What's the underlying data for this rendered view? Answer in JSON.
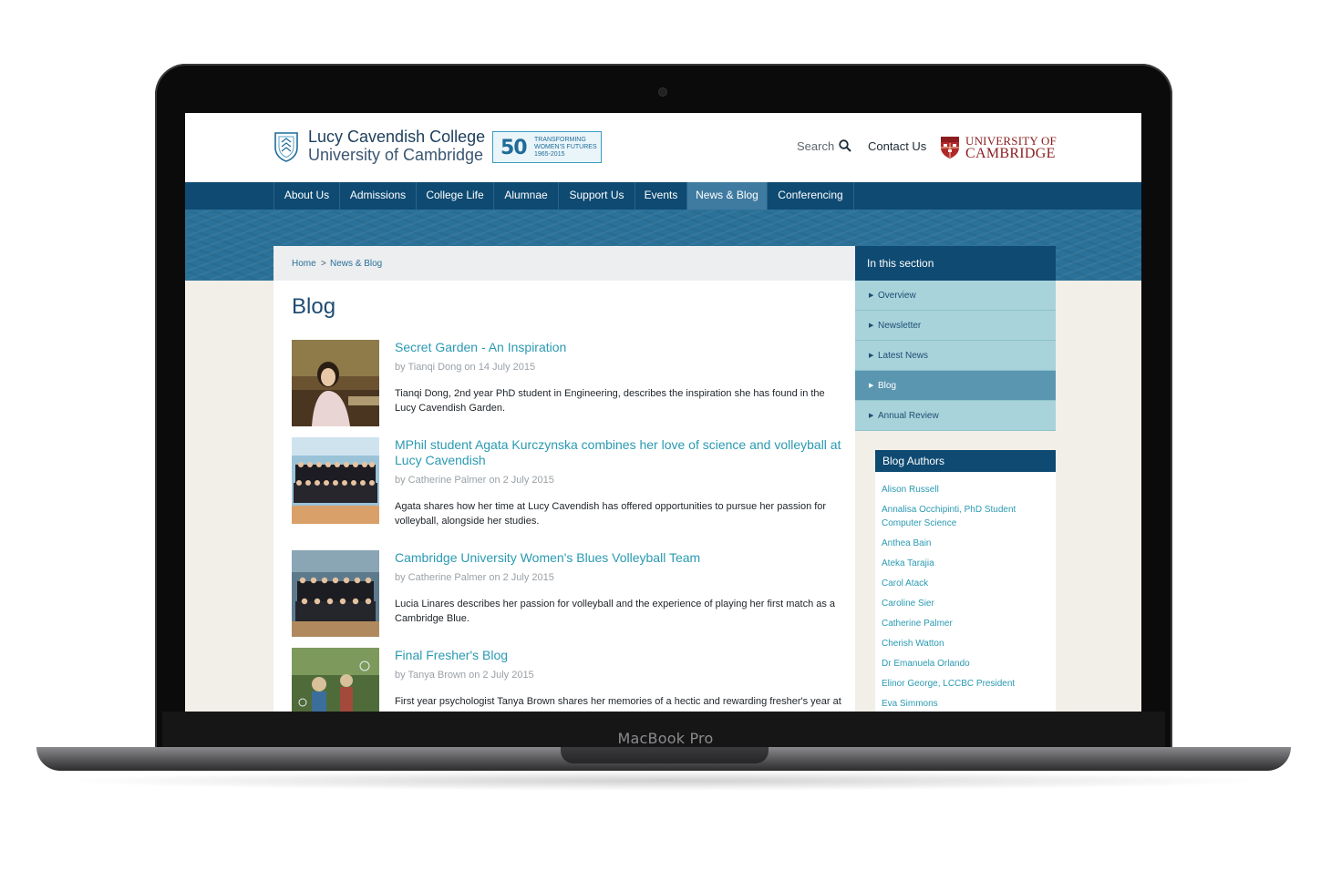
{
  "device": {
    "label": "MacBook Pro"
  },
  "header": {
    "college_name": "Lucy Cavendish College",
    "college_sub": "University of Cambridge",
    "anniversary_num": "50",
    "anniversary_text": "TRANSFORMING WOMEN'S FUTURES 1965-2015",
    "search_label": "Search",
    "contact_label": "Contact Us",
    "uni_line1": "UNIVERSITY OF",
    "uni_line2": "CAMBRIDGE"
  },
  "nav": {
    "items": [
      {
        "label": "About Us"
      },
      {
        "label": "Admissions"
      },
      {
        "label": "College Life"
      },
      {
        "label": "Alumnae"
      },
      {
        "label": "Support Us"
      },
      {
        "label": "Events"
      },
      {
        "label": "News & Blog"
      },
      {
        "label": "Conferencing"
      }
    ],
    "active": "News & Blog"
  },
  "breadcrumb": {
    "home": "Home",
    "separator": ">",
    "current": "News & Blog"
  },
  "page_title": "Blog",
  "posts": [
    {
      "title": "Secret Garden - An Inspiration",
      "meta": "by Tianqi Dong on 14 July 2015",
      "excerpt": "Tianqi Dong, 2nd year PhD student in Engineering, describes the inspiration she has found in the Lucy Cavendish Garden."
    },
    {
      "title": "MPhil student Agata Kurczynska combines her love of science and volleyball at Lucy Cavendish",
      "meta": "by Catherine Palmer on 2 July 2015",
      "excerpt": "Agata shares how her time at Lucy Cavendish has offered opportunities to pursue her passion for volleyball, alongside her studies."
    },
    {
      "title": "Cambridge University Women's Blues Volleyball Team",
      "meta": "by Catherine Palmer on 2 July 2015",
      "excerpt": "Lucia Linares describes her passion for volleyball and the experience of playing her first match as a Cambridge Blue."
    },
    {
      "title": "Final Fresher's Blog",
      "meta": "by Tanya Brown on 2 July 2015",
      "excerpt": "First year psychologist Tanya Brown shares her memories of a hectic and rewarding fresher's year at"
    }
  ],
  "sidebar": {
    "heading": "In this section",
    "items": [
      {
        "label": "Overview"
      },
      {
        "label": "Newsletter"
      },
      {
        "label": "Latest News"
      },
      {
        "label": "Blog"
      },
      {
        "label": "Annual Review"
      }
    ],
    "active": "Blog"
  },
  "authors": {
    "heading": "Blog Authors",
    "items": [
      "Alison Russell",
      "Annalisa Occhipinti, PhD Student Computer Science",
      "Anthea Bain",
      "Ateka Tarajia",
      "Carol Atack",
      "Caroline Sier",
      "Catherine Palmer",
      "Cherish Watton",
      "Dr Emanuela Orlando",
      "Elinor George, LCCBC President",
      "Eva Simmons"
    ]
  },
  "colors": {
    "nav": "#0e4a72",
    "banner": "#2b7198",
    "link": "#2a9ab2",
    "side_item": "#a8d3db",
    "side_active": "#5a96b0"
  }
}
